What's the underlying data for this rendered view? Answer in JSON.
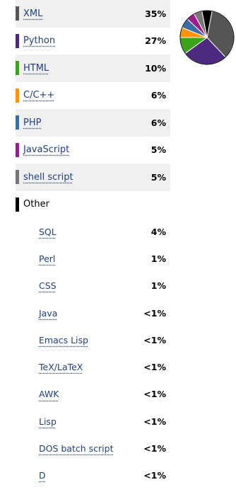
{
  "languages": [
    {
      "name": "XML",
      "pct": "35%",
      "color": "#555555"
    },
    {
      "name": "Python",
      "pct": "27%",
      "color": "#4b2a80"
    },
    {
      "name": "HTML",
      "pct": "10%",
      "color": "#3aa31a"
    },
    {
      "name": "C/C++",
      "pct": "6%",
      "color": "#ff9300"
    },
    {
      "name": "PHP",
      "pct": "6%",
      "color": "#3a6ea5"
    },
    {
      "name": "JavaScript",
      "pct": "5%",
      "color": "#9b1c8f"
    },
    {
      "name": "shell script",
      "pct": "5%",
      "color": "#777777"
    }
  ],
  "other": {
    "label": "Other",
    "color": "#000000",
    "items": [
      {
        "name": "SQL",
        "pct": "4%"
      },
      {
        "name": "Perl",
        "pct": "1%"
      },
      {
        "name": "CSS",
        "pct": "1%"
      },
      {
        "name": "Java",
        "pct": "<1%"
      },
      {
        "name": "Emacs Lisp",
        "pct": "<1%"
      },
      {
        "name": "TeX/LaTeX",
        "pct": "<1%"
      },
      {
        "name": "AWK",
        "pct": "<1%"
      },
      {
        "name": "Lisp",
        "pct": "<1%"
      },
      {
        "name": "DOS batch script",
        "pct": "<1%"
      },
      {
        "name": "D",
        "pct": "<1%"
      }
    ]
  },
  "chart_data": {
    "type": "pie",
    "categories": [
      "XML",
      "Python",
      "HTML",
      "C/C++",
      "PHP",
      "JavaScript",
      "shell script",
      "Other"
    ],
    "values": [
      35,
      27,
      10,
      6,
      6,
      5,
      5,
      6
    ],
    "colors": [
      "#555555",
      "#4b2a80",
      "#3aa31a",
      "#ff9300",
      "#3a6ea5",
      "#9b1c8f",
      "#777777",
      "#000000"
    ]
  }
}
